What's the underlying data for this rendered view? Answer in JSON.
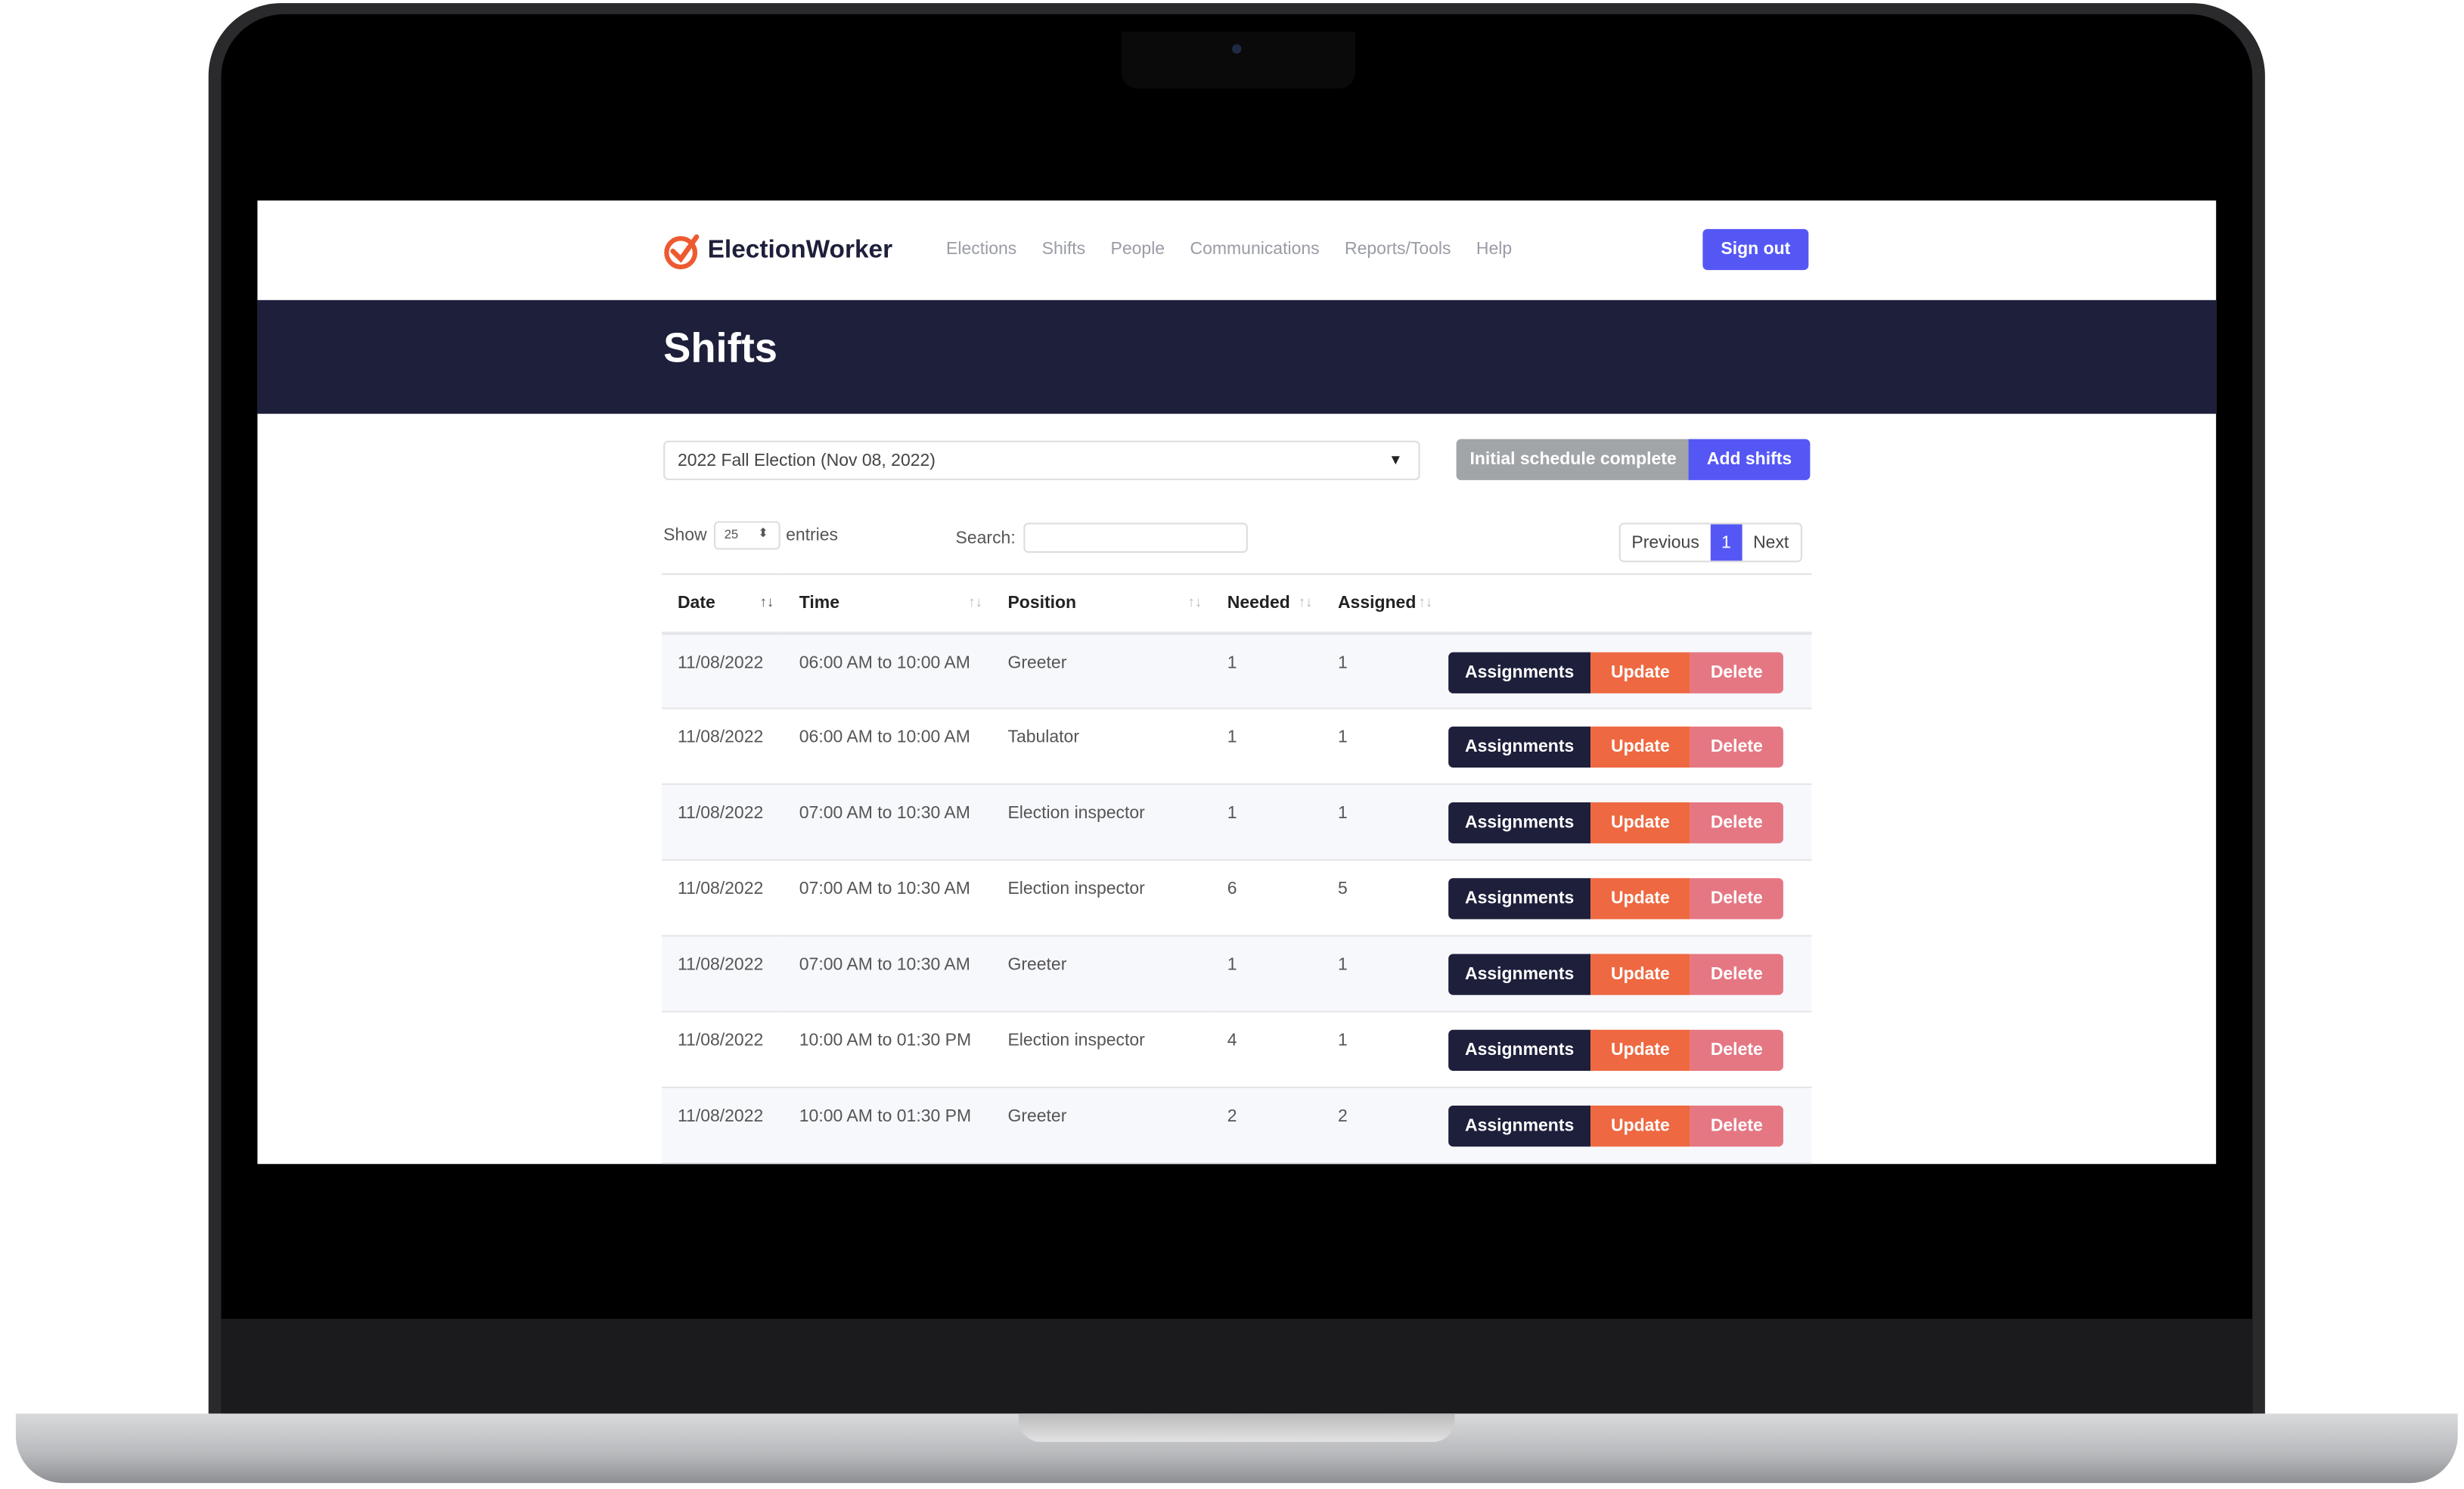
{
  "brand": {
    "name": "ElectionWorker",
    "color": "#ee5a30"
  },
  "nav": {
    "items": [
      "Elections",
      "Shifts",
      "People",
      "Communications",
      "Reports/Tools",
      "Help"
    ],
    "sign_out": "Sign out"
  },
  "page": {
    "title": "Shifts"
  },
  "election_select": {
    "value": "2022 Fall Election (Nov 08, 2022)"
  },
  "actions": {
    "initial_schedule": "Initial schedule complete",
    "add_shifts": "Add shifts"
  },
  "table_controls": {
    "show": "Show",
    "entries_value": "25",
    "entries": "entries",
    "search_label": "Search:",
    "search_value": "",
    "previous": "Previous",
    "page": "1",
    "next": "Next"
  },
  "table": {
    "columns": [
      "Date",
      "Time",
      "Position",
      "Needed",
      "Assigned"
    ],
    "row_actions": {
      "assignments": "Assignments",
      "update": "Update",
      "delete": "Delete"
    },
    "rows": [
      [
        "11/08/2022",
        "06:00 AM to 10:00 AM",
        "Greeter",
        "1",
        "1"
      ],
      [
        "11/08/2022",
        "06:00 AM to 10:00 AM",
        "Tabulator",
        "1",
        "1"
      ],
      [
        "11/08/2022",
        "07:00 AM to 10:30 AM",
        "Election inspector",
        "1",
        "1"
      ],
      [
        "11/08/2022",
        "07:00 AM to 10:30 AM",
        "Election inspector",
        "6",
        "5"
      ],
      [
        "11/08/2022",
        "07:00 AM to 10:30 AM",
        "Greeter",
        "1",
        "1"
      ],
      [
        "11/08/2022",
        "10:00 AM to 01:30 PM",
        "Election inspector",
        "4",
        "1"
      ],
      [
        "11/08/2022",
        "10:00 AM to 01:30 PM",
        "Greeter",
        "2",
        "2"
      ]
    ]
  },
  "colors": {
    "primary": "#5557f5",
    "navy": "#1d1f3b",
    "update": "#ee6841",
    "delete": "#e57783",
    "muted": "#a1a5a8"
  }
}
